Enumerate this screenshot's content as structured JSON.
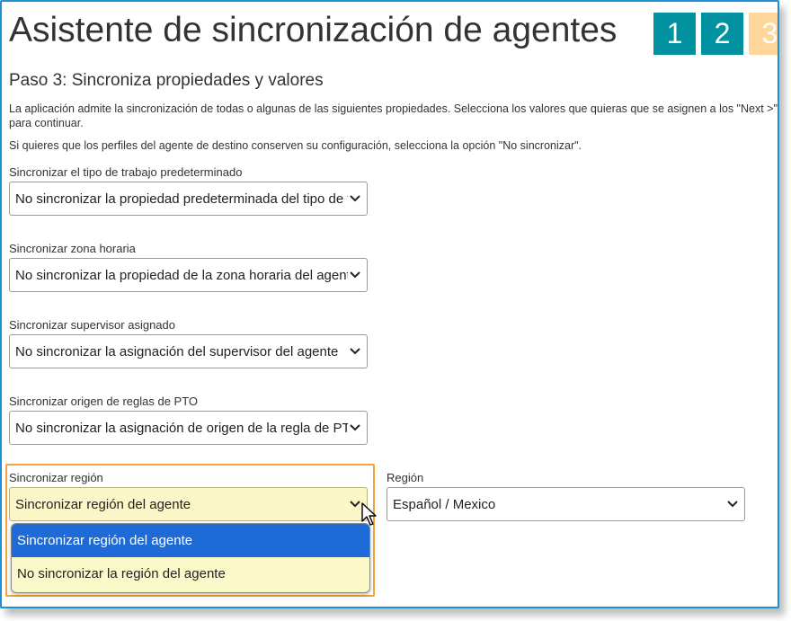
{
  "title": "Asistente de sincronización de agentes",
  "steps": [
    {
      "label": "1",
      "state": "done"
    },
    {
      "label": "2",
      "state": "done"
    },
    {
      "label": "3",
      "state": "next"
    }
  ],
  "subtitle": "Paso 3: Sincroniza propiedades y valores",
  "description": "La aplicación admite la sincronización de todas o algunas de las siguientes propiedades. Selecciona los valores que quieras que se asignen a los \"Next >\" para continuar.",
  "description2": "Si quieres que los perfiles del agente de destino conserven su configuración, selecciona la opción \"No sincronizar\".",
  "fields": [
    {
      "label": "Sincronizar el tipo de trabajo predeterminado",
      "value": "No sincronizar la propiedad predeterminada del tipo de trabajo"
    },
    {
      "label": "Sincronizar zona horaria",
      "value": "No sincronizar la propiedad de la zona horaria del agente"
    },
    {
      "label": "Sincronizar supervisor asignado",
      "value": "No sincronizar la asignación del supervisor del agente"
    },
    {
      "label": "Sincronizar origen de reglas de PTO",
      "value": "No sincronizar la asignación de origen de la regla de PTO"
    }
  ],
  "region_sync": {
    "label": "Sincronizar región",
    "value": "Sincronizar región del agente",
    "options": [
      "Sincronizar región del agente",
      "No sincronizar la región del agente"
    ]
  },
  "region": {
    "label": "Región",
    "value": "Español / Mexico"
  },
  "colors": {
    "accent": "#00929f",
    "next_step": "#ffd79b",
    "highlight": "#f0a43a",
    "selected_option": "#1e6ad6",
    "border": "#1f8fd6"
  }
}
